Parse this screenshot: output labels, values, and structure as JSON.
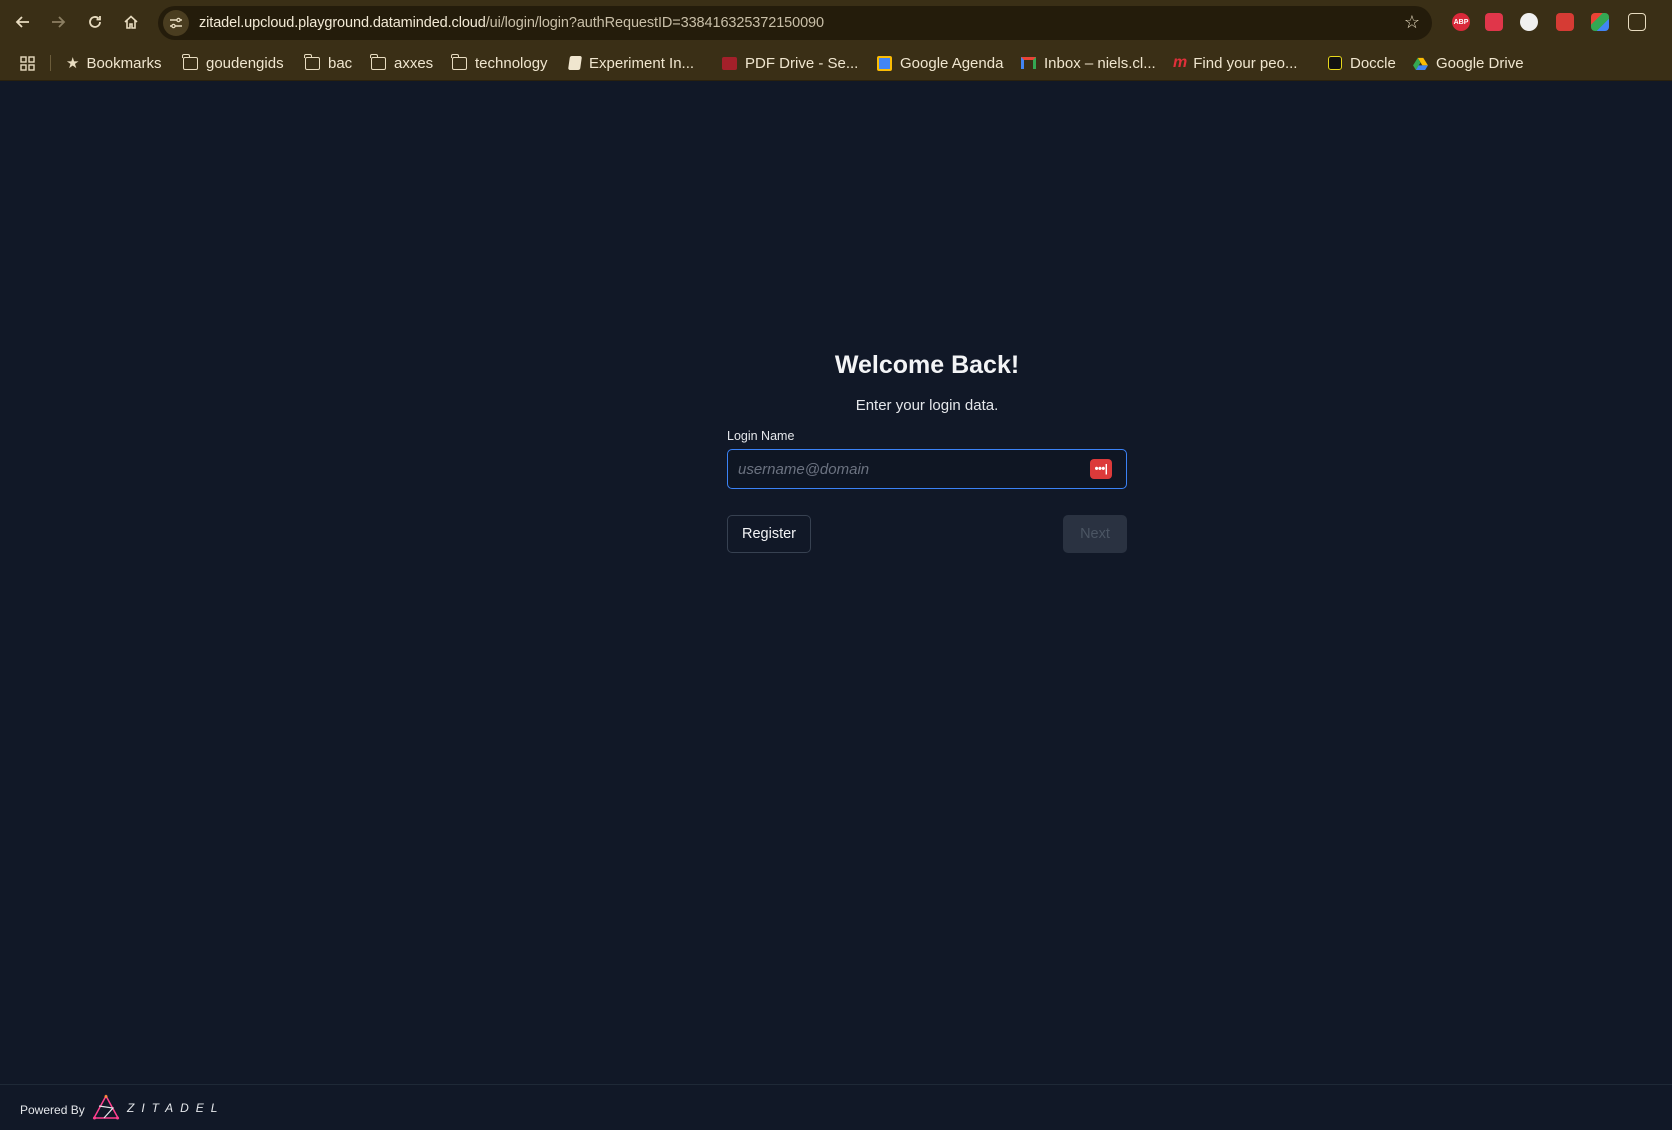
{
  "browser": {
    "url_host": "zitadel.upcloud.playground.dataminded.cloud",
    "url_path": "/ui/login/login?authRequestID=338416325372150090",
    "bookmarks": [
      {
        "label": "Bookmarks",
        "icon": "star-icon"
      },
      {
        "label": "goudengids",
        "icon": "folder-icon"
      },
      {
        "label": "bac",
        "icon": "folder-icon"
      },
      {
        "label": "axxes",
        "icon": "folder-icon"
      },
      {
        "label": "technology",
        "icon": "folder-icon"
      },
      {
        "label": "Experiment In...",
        "icon": "page-icon"
      },
      {
        "label": "PDF Drive - Se...",
        "icon": "pdf-drive-icon"
      },
      {
        "label": "Google Agenda",
        "icon": "calendar-icon"
      },
      {
        "label": "Inbox – niels.cl...",
        "icon": "gmail-icon"
      },
      {
        "label": "Find your peo...",
        "icon": "m-icon"
      },
      {
        "label": "Doccle",
        "icon": "doccle-icon"
      },
      {
        "label": "Google Drive",
        "icon": "drive-icon"
      }
    ],
    "extensions": {
      "abp": "ABP"
    }
  },
  "login": {
    "title": "Welcome Back!",
    "subtitle": "Enter your login data.",
    "field_label": "Login Name",
    "placeholder": "username@domain",
    "register_label": "Register",
    "next_label": "Next"
  },
  "footer": {
    "powered_by": "Powered By",
    "brand": "ZITADEL"
  },
  "colors": {
    "background": "#111827",
    "accent": "#3b82f6",
    "browser_chrome": "#3a2f16"
  }
}
